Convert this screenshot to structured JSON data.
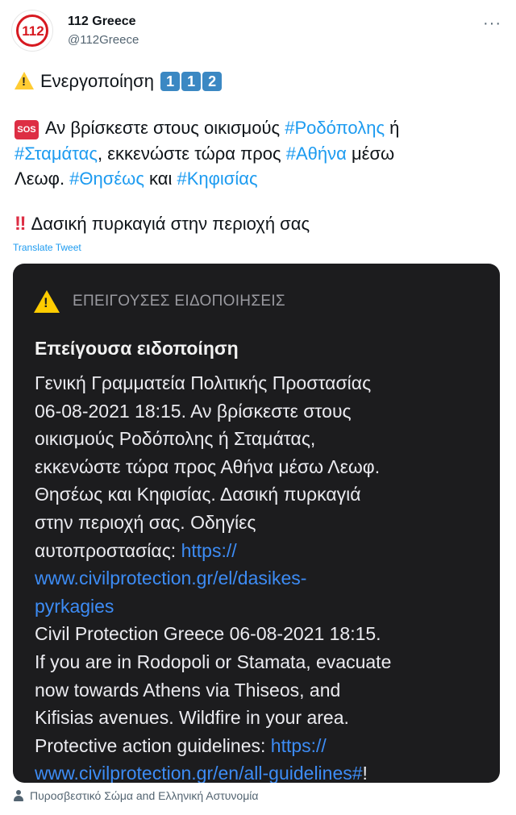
{
  "account": {
    "name": "112 Greece",
    "handle": "@112Greece",
    "avatar_text": "112",
    "more_label": "···"
  },
  "tweet": {
    "line1": {
      "text": "Ενεργοποίηση",
      "keys": [
        "1",
        "1",
        "2"
      ]
    },
    "sos_badge": "SOS",
    "line2": {
      "a": "Αν βρίσκεστε στους οικισμούς ",
      "tag1": "#Ροδόπολης",
      "b": " ή"
    },
    "line3": {
      "tag2": "#Σταμάτας",
      "a": ", εκκενώστε τώρα προς ",
      "tag3": "#Αθήνα",
      "b": " μέσω"
    },
    "line4": {
      "a": "Λεωφ. ",
      "tag4": "#Θησέως",
      "b": " και ",
      "tag5": "#Κηφισίας"
    },
    "bang_icon": "‼",
    "line5": "Δασική πυρκαγιά στην περιοχή σας",
    "translate_label": "Translate Tweet"
  },
  "alert_card": {
    "header": "ΕΠΕΙΓΟΥΣΕΣ ΕΙΔΟΠΟΙΗΣΕΙΣ",
    "title": "Επείγουσα ειδοποίηση",
    "lines": [
      "Γενική Γραμματεία Πολιτικής Προστασίας",
      "06-08-2021 18:15. Αν βρίσκεστε στους",
      "οικισμούς Ροδόπολης ή Σταμάτας,",
      "εκκενώστε τώρα προς Αθήνα μέσω Λεωφ.",
      "Θησέως και Κηφισίας. Δασική πυρκαγιά",
      "στην περιοχή σας. Οδηγίες"
    ],
    "line_guides_el": "αυτοπροστασίας: ",
    "link_el_1": "https://",
    "link_el_2": "www.civilprotection.gr/el/dasikes-",
    "link_el_3": "pyrkagies",
    "lines_en": [
      "Civil Protection Greece 06-08-2021 18:15.",
      "If you are in Rodopoli or Stamata, evacuate",
      "now towards Athens via Thiseos, and",
      "Kifisias avenues. Wildfire in your area."
    ],
    "line_guides_en": "Protective action guidelines: ",
    "link_en_1": "https://",
    "link_en_2": "www.civilprotection.gr/en/all-guidelines#",
    "link_en_end": "!"
  },
  "footer": {
    "tagged": "Πυροσβεστικό Σώμα and Ελληνική Αστυνομία"
  },
  "colors": {
    "link": "#1d9bf0",
    "card_bg": "#1c1c1e",
    "card_link": "#3d8cf5",
    "warning_yellow": "#ffcc00",
    "brand_red": "#d71920"
  }
}
